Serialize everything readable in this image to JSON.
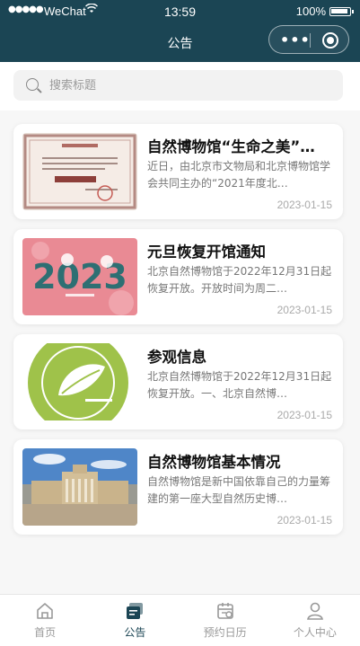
{
  "status_bar": {
    "signal": "●●●●●",
    "carrier": "WeChat",
    "time": "13:59",
    "battery": "100%"
  },
  "header": {
    "title": "公告"
  },
  "search": {
    "placeholder": "搜索标题",
    "value": ""
  },
  "articles": [
    {
      "title": "自然博物馆“生命之美”…",
      "summary": "近日，由北京市文物局和北京博物馆学会共同主办的“2021年度北…",
      "date": "2023-01-15",
      "image": "certificate-image"
    },
    {
      "title": "元旦恢复开馆通知",
      "summary": "北京自然博物馆于2022年12月31日起恢复开放。开放时间为周二…",
      "date": "2023-01-15",
      "image": "new-year-2023-image"
    },
    {
      "title": "参观信息",
      "summary": "北京自然博物馆于2022年12月31日起恢复开放。一、北京自然博…",
      "date": "2023-01-15",
      "image": "museum-logo-image"
    },
    {
      "title": "自然博物馆基本情况",
      "summary": "自然博物馆是新中国依靠自己的力量筹建的第一座大型自然历史博…",
      "date": "2023-01-15",
      "image": "museum-building-image"
    }
  ],
  "tabbar": {
    "items": [
      {
        "label": "首页",
        "icon": "home-icon",
        "active": false
      },
      {
        "label": "公告",
        "icon": "announcement-icon",
        "active": true
      },
      {
        "label": "预约日历",
        "icon": "calendar-icon",
        "active": false
      },
      {
        "label": "个人中心",
        "icon": "person-icon",
        "active": false
      }
    ]
  },
  "colors": {
    "primary": "#1b4554",
    "background": "#f7f7f7",
    "muted_text": "#777777",
    "date_text": "#aaaaaa"
  }
}
